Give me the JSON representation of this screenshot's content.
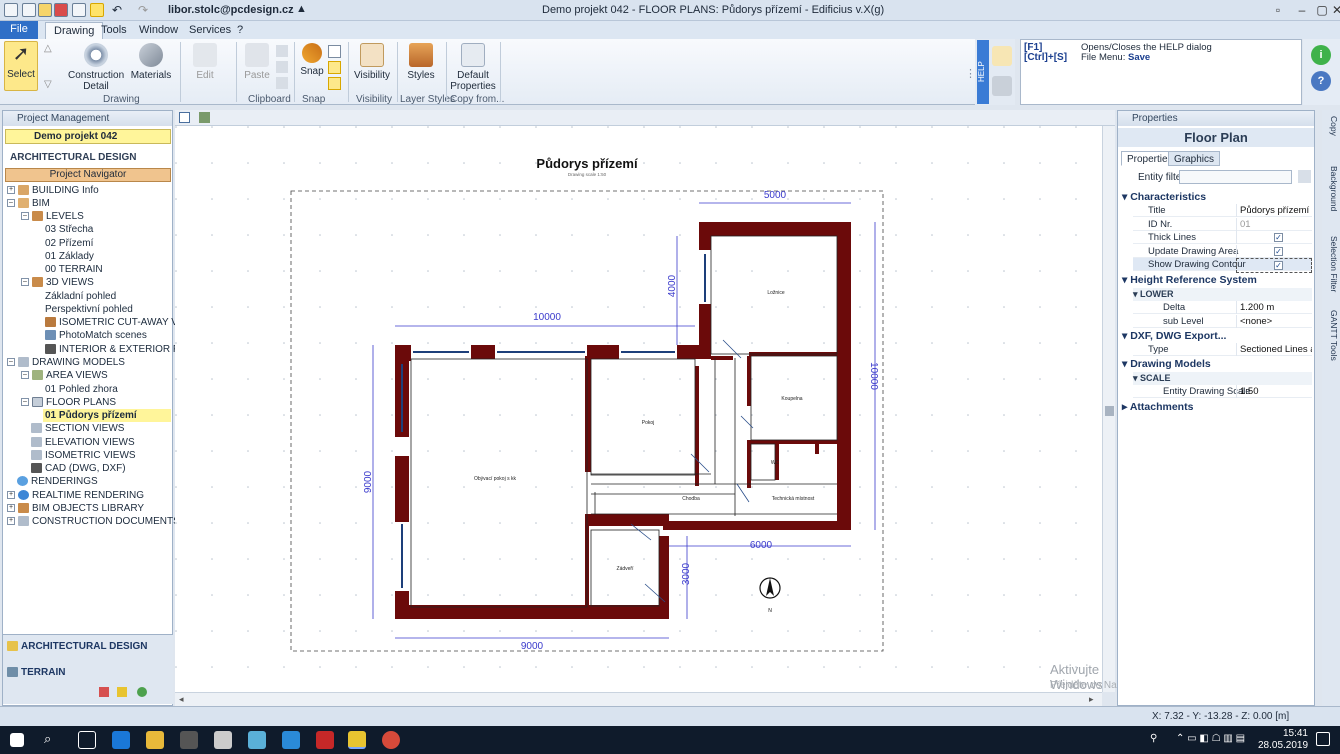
{
  "titlebar": {
    "user_email": "libor.stolc@pcdesign.cz",
    "window_title": "Demo projekt 042 -  FLOOR PLANS: Půdorys přízemí - Edificius v.X(g)"
  },
  "tabs": [
    "File",
    "Drawing",
    "Tools",
    "Window",
    "Services",
    "?"
  ],
  "ribbon": {
    "select": "Select",
    "construction_detail": "Construction Detail",
    "materials": "Materials",
    "edit": "Edit",
    "paste": "Paste",
    "snap": "Snap",
    "visibility": "Visibility",
    "styles": "Styles",
    "default_properties": "Default Properties",
    "groups": {
      "drawing": "Drawing",
      "clipboard": "Clipboard",
      "snap": "Snap",
      "visibility": "Visibility",
      "layer_styles": "Layer Styles",
      "copy_from": "Copy from..."
    }
  },
  "help": {
    "tag": "HELP",
    "key1": "[F1]",
    "desc1": "Opens/Closes the HELP dialog",
    "key2": "[Ctrl]+[S]",
    "desc2_prefix": "File Menu: ",
    "desc2_bold": "Save",
    "desc1_bold": "HELP"
  },
  "left_panel": {
    "header": "Project Management",
    "project": "Demo projekt 042",
    "section": "ARCHITECTURAL DESIGN",
    "navigator": "Project Navigator",
    "tree": [
      "BUILDING Info",
      "BIM",
      "LEVELS",
      "03 Střecha",
      "02 Přízemí",
      "01 Základy",
      "00 TERRAIN",
      "3D VIEWS",
      "Základní pohled",
      "Perspektivní pohled",
      "ISOMETRIC CUT-AWAY VIEWS",
      "PhotoMatch scenes",
      "INTERIOR & EXTERIOR PHOTO",
      "DRAWING MODELS",
      "AREA VIEWS",
      "01 Pohled zhora",
      "FLOOR PLANS",
      "01 Půdorys přízemí",
      "SECTION VIEWS",
      "ELEVATION VIEWS",
      "ISOMETRIC VIEWS",
      "CAD (DWG, DXF)",
      "RENDERINGS",
      "REALTIME RENDERING",
      "BIM OBJECTS LIBRARY",
      "CONSTRUCTION DOCUMENTS"
    ],
    "bottom_arch": "ARCHITECTURAL DESIGN",
    "bottom_terrain": "TERRAIN"
  },
  "drawing": {
    "title": "Půdorys přízemí",
    "subtitle": "Drawing scale 1:50",
    "dims": {
      "top_right": "5000",
      "top_main": "10000",
      "left_upper": "4000",
      "right": "10000",
      "left": "9000",
      "bottom_right": "6000",
      "bottom_mid": "3000",
      "bottom": "9000"
    },
    "rooms": {
      "ložnice": "Ložnice",
      "pokoj": "Pokoj",
      "koupelna": "Koupelna",
      "wc": "WC",
      "obyvaci": "Obývací pokoj s kk",
      "chodba": "Chodba",
      "technicka": "Technická místnost",
      "zadveri": "Zádveří"
    },
    "north": "N"
  },
  "properties": {
    "header": "Properties",
    "title": "Floor Plan",
    "tabs": [
      "Properties",
      "Graphics"
    ],
    "entity_filter": "Entity filter",
    "sections": {
      "characteristics": "Characteristics",
      "height_ref": "Height Reference System",
      "dxf": "DXF, DWG Export...",
      "drawing_models": "Drawing Models",
      "attachments": "Attachments"
    },
    "rows": {
      "title_k": "Title",
      "title_v": "Půdorys přízemí",
      "id_k": "ID Nr.",
      "id_v": "01",
      "thick_k": "Thick Lines",
      "update_k": "Update Drawing Area",
      "contour_k": "Show Drawing Contour",
      "lower": "LOWER",
      "delta_k": "Delta",
      "delta_v": "1.200 m",
      "sublevel_k": "sub Level",
      "sublevel_v": "<none>",
      "type_k": "Type",
      "type_v": "Sectioned Lines and Ha",
      "scale": "SCALE",
      "eds_k": "Entity Drawing Scale",
      "eds_v": "1:50"
    }
  },
  "side_tabs": [
    "Copy",
    "Background",
    "Selection Filter",
    "GANTT Tools"
  ],
  "status": {
    "coords": "X: 7.32 - Y: -13.28 - Z: 0.00 [m]"
  },
  "watermark": {
    "line1": "Aktivujte Windows",
    "line2": "Přejděte do Nastavení a aktivujte systém Windows."
  },
  "taskbar": {
    "time": "15:41",
    "date": "28.05.2019"
  },
  "colors": {
    "wall": "#6b0a0a",
    "dim": "#3a3acc",
    "accent": "#2f6fc7",
    "highlight": "#fff59a"
  }
}
